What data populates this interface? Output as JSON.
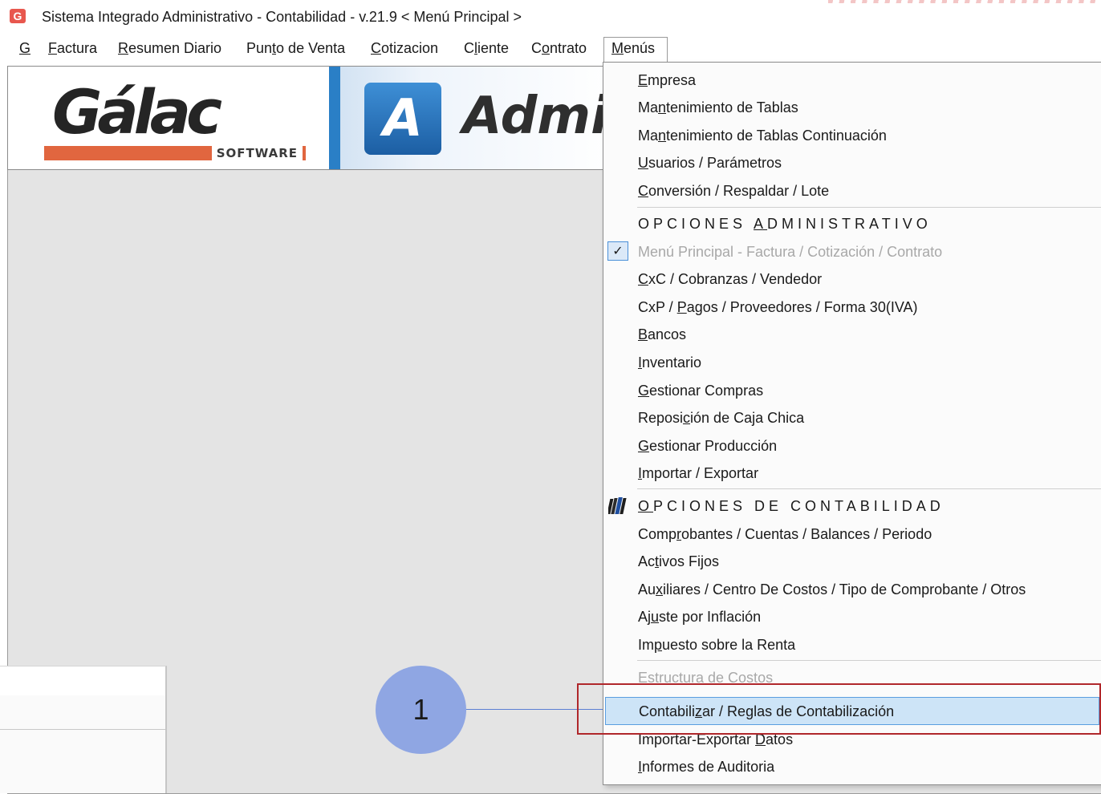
{
  "window": {
    "title": "Sistema Integrado Administrativo - Contabilidad - v.21.9 < Menú Principal >",
    "app_icon_letter": "G",
    "app_icon_name": "galac-app-icon"
  },
  "menubar": {
    "items": [
      {
        "pre": "",
        "ul": "G",
        "post": ""
      },
      {
        "pre": "",
        "ul": "F",
        "post": "actura"
      },
      {
        "pre": "",
        "ul": "R",
        "post": "esumen Diario"
      },
      {
        "pre": "Pun",
        "ul": "t",
        "post": "o de Venta"
      },
      {
        "pre": "",
        "ul": "C",
        "post": "otizacion"
      },
      {
        "pre": "C",
        "ul": "l",
        "post": "iente"
      },
      {
        "pre": "C",
        "ul": "o",
        "post": "ntrato"
      },
      {
        "pre": "",
        "ul": "M",
        "post": "enús"
      }
    ]
  },
  "banner": {
    "brand": "Gálac",
    "brand_sub": "SOFTWARE",
    "product_letter": "A",
    "product_text": "Admi"
  },
  "menu": {
    "items": [
      {
        "pre": "",
        "ul": "E",
        "post": "mpresa"
      },
      {
        "pre": "Ma",
        "ul": "n",
        "post": "tenimiento de Tablas"
      },
      {
        "pre": "Ma",
        "ul": "n",
        "post": "tenimiento de Tablas Continuación"
      },
      {
        "pre": "",
        "ul": "U",
        "post": "suarios / Parámetros"
      },
      {
        "pre": "",
        "ul": "C",
        "post": "onversión / Respaldar / Lote"
      },
      {
        "pre": "OPCIONES ",
        "ul": "A",
        "post": "DMINISTRATIVO"
      },
      {
        "pre": "Menú Principal - Factura / Cotización / Contrato",
        "ul": "",
        "post": ""
      },
      {
        "pre": "",
        "ul": "C",
        "post": "xC / Cobranzas / Vendedor"
      },
      {
        "pre": "CxP / ",
        "ul": "P",
        "post": "agos / Proveedores / Forma 30(IVA)"
      },
      {
        "pre": "",
        "ul": "B",
        "post": "ancos"
      },
      {
        "pre": "",
        "ul": "I",
        "post": "nventario"
      },
      {
        "pre": "",
        "ul": "G",
        "post": "estionar Compras"
      },
      {
        "pre": "Reposi",
        "ul": "c",
        "post": "ión de Caja Chica"
      },
      {
        "pre": "",
        "ul": "G",
        "post": "estionar Producción"
      },
      {
        "pre": "",
        "ul": "I",
        "post": "mportar / Exportar"
      },
      {
        "pre": "",
        "ul": "O",
        "post": "PCIONES DE CONTABILIDAD"
      },
      {
        "pre": "Comp",
        "ul": "r",
        "post": "obantes / Cuentas / Balances / Periodo"
      },
      {
        "pre": "Ac",
        "ul": "t",
        "post": "ivos Fijos"
      },
      {
        "pre": "Au",
        "ul": "x",
        "post": "iliares / Centro De Costos / Tipo de Comprobante / Otros"
      },
      {
        "pre": "Aj",
        "ul": "u",
        "post": "ste por Inflación"
      },
      {
        "pre": "Im",
        "ul": "p",
        "post": "uesto sobre la Renta"
      },
      {
        "pre": "Estructura de Costos",
        "ul": "",
        "post": ""
      },
      {
        "pre": "Contabili",
        "ul": "z",
        "post": "ar / Reglas de Contabilización"
      },
      {
        "pre": "Importar-Exportar ",
        "ul": "D",
        "post": "atos"
      },
      {
        "pre": "",
        "ul": "I",
        "post": "nformes de Auditoria"
      }
    ],
    "checked_item": "Menú Principal - Factura / Cotización / Contrato",
    "check_glyph": "✓",
    "highlighted_item": "Contabilizar / Reglas de Contabilización"
  },
  "callout": {
    "number": "1"
  },
  "colors": {
    "highlight_bg": "#cde4f7",
    "highlight_border": "#5a9ee0",
    "annotation_frame": "#b0272b",
    "callout_fill": "#8fa6e3",
    "galac_orange": "#e1663f"
  }
}
